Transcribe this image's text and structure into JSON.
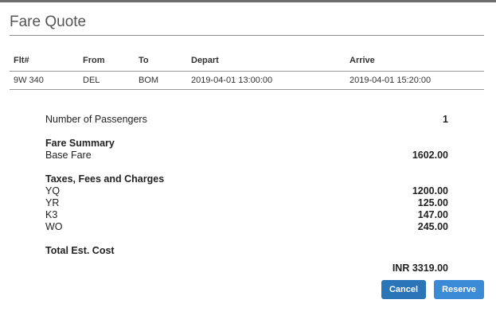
{
  "dialog": {
    "title": "Fare Quote"
  },
  "flights": {
    "headers": [
      "Flt#",
      "From",
      "To",
      "Depart",
      "Arrive"
    ],
    "rows": [
      [
        "9W 340",
        "DEL",
        "BOM",
        "2019-04-01 13:00:00",
        "2019-04-01 15:20:00"
      ]
    ]
  },
  "summary": {
    "passengers_label": "Number of Passengers",
    "passengers_value": "1",
    "fare_summary_heading": "Fare Summary",
    "base_fare_label": "Base Fare",
    "base_fare_value": "1602.00",
    "taxes_heading": "Taxes, Fees and Charges",
    "taxes": [
      {
        "label": "YQ",
        "value": "1200.00"
      },
      {
        "label": "YR",
        "value": "125.00"
      },
      {
        "label": "K3",
        "value": "147.00"
      },
      {
        "label": "WO",
        "value": "245.00"
      }
    ],
    "total_label": "Total Est. Cost",
    "total_value": "INR 3319.00"
  },
  "actions": {
    "cancel_label": "Cancel",
    "reserve_label": "Reserve"
  },
  "colors": {
    "cancel_button": "#2a75b8",
    "reserve_button": "#3a8ad6"
  }
}
